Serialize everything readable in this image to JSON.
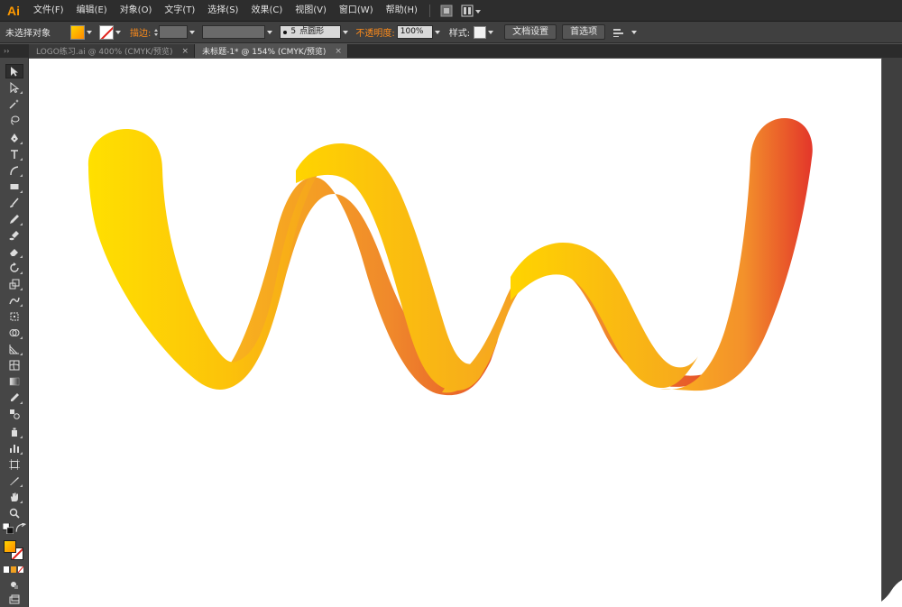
{
  "app": {
    "logo": "Ai"
  },
  "menu": {
    "items": [
      "文件(F)",
      "编辑(E)",
      "对象(O)",
      "文字(T)",
      "选择(S)",
      "效果(C)",
      "视图(V)",
      "窗口(W)",
      "帮助(H)"
    ]
  },
  "control": {
    "selection_status": "未选择对象",
    "stroke_label": "描边:",
    "brush_size": "5",
    "brush_name": "点圆形",
    "opacity_label": "不透明度:",
    "opacity_value": "100%",
    "style_label": "样式:",
    "doc_setup": "文档设置",
    "preferences": "首选项"
  },
  "tabs": [
    {
      "label": "LOGO练习.ai @ 400% (CMYK/预览)",
      "active": false
    },
    {
      "label": "未标题-1* @ 154% (CMYK/预览)",
      "active": true
    }
  ],
  "toolbar": {
    "header": "››"
  },
  "colors": {
    "gradient_start": "#ffe000",
    "gradient_mid": "#f9a41f",
    "gradient_end": "#e83a25",
    "accent_orange": "#ff8c1a"
  }
}
